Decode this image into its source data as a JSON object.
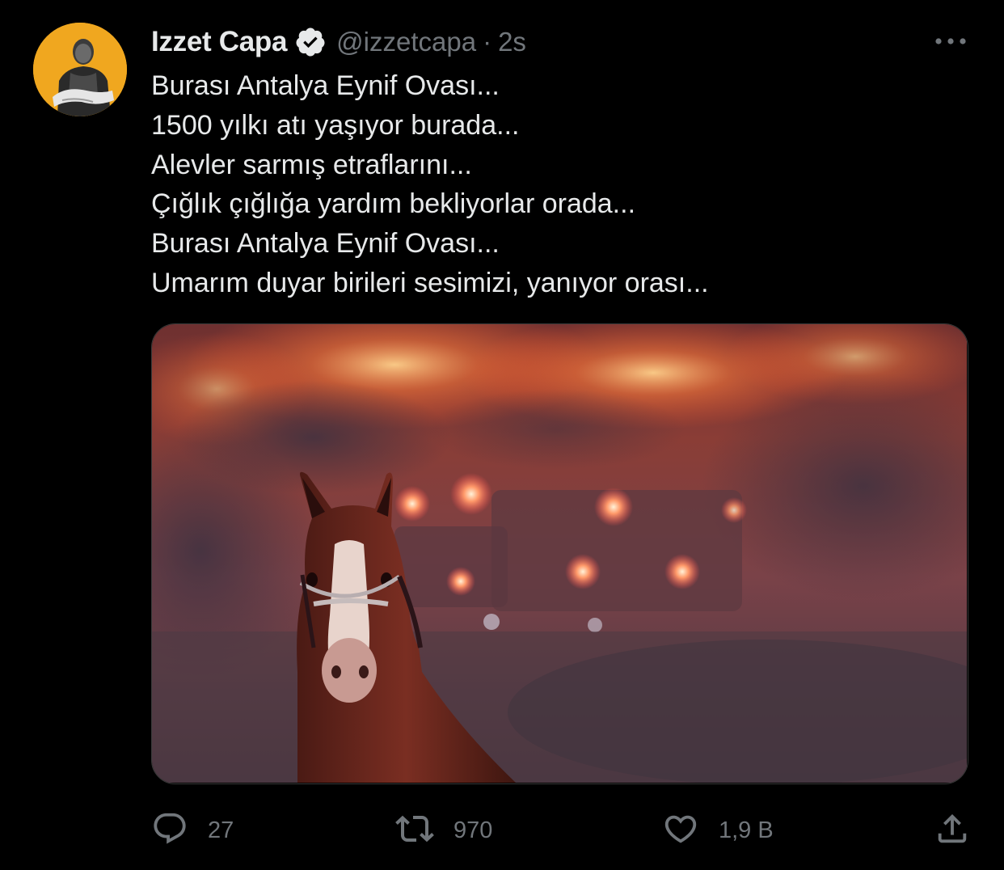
{
  "tweet": {
    "author": {
      "display_name": "Izzet Capa",
      "verified": true,
      "handle": "@izzetcapa",
      "separator": "·",
      "time": "2s"
    },
    "lines": [
      "Burası Antalya Eynif Ovası...",
      "1500 yılkı atı yaşıyor burada...",
      "Alevler sarmış etraflarını...",
      "Çığlık çığlığa yardım bekliyorlar orada...",
      "Burası Antalya Eynif Ovası...",
      "Umarım duyar birileri sesimizi, yanıyor orası..."
    ],
    "media": {
      "icon": "photo-horse-fire"
    },
    "actions": {
      "reply_count": "27",
      "retweet_count": "970",
      "like_count": "1,9 B"
    }
  },
  "colors": {
    "background": "#000000",
    "text_primary": "#e7e9ea",
    "text_secondary": "#71767b",
    "avatar_bg": "#f0a71f"
  }
}
